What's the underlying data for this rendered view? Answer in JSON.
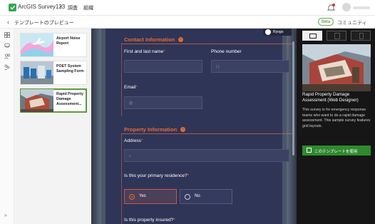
{
  "topbar": {
    "app_title": "ArcGIS Survey123",
    "nav_survey": "調査",
    "nav_org": "組織",
    "icons": {
      "logo": "survey123-logo-icon",
      "notification": "bell-icon",
      "account": "avatar"
    },
    "colors": {
      "notification_dot": "#d83020"
    }
  },
  "subheader": {
    "back_glyph": "‹",
    "title": "テンプレートのプレビュー",
    "beta": "Beta",
    "community": "コミュニティ"
  },
  "templates": [
    {
      "name": "Airport Noise Report"
    },
    {
      "name": "POET System Sampling Form"
    },
    {
      "name": "Rapid Property Damage Assessment...",
      "selected": true
    }
  ],
  "form": {
    "account_chip": "Ryogo",
    "sections": {
      "contact": {
        "title": "Contact Information",
        "icon": "collapse-icon"
      },
      "property": {
        "title": "Property Information",
        "icon": "collapse-icon"
      }
    },
    "fields": {
      "first_last_name": {
        "label": "First and last name",
        "required": "*",
        "value": ""
      },
      "phone": {
        "label": "Phone number",
        "value": "",
        "hint": "(   )"
      },
      "email": {
        "label": "Email",
        "required": "*",
        "hint": "@"
      },
      "address": {
        "label": "Address",
        "required": "*",
        "hint": "⌕"
      },
      "primary_residence": {
        "label": "Is this your primary residence?",
        "required": "*",
        "options": [
          "Yes",
          "No"
        ],
        "selected": "Yes"
      },
      "insured": {
        "label": "Is this property insured?",
        "required": "*"
      }
    },
    "colors": {
      "accent": "#e06a3c",
      "card": "#2f3557"
    }
  },
  "preview_panel": {
    "devices": [
      "desktop-icon",
      "tablet-icon",
      "phone-icon"
    ],
    "active_device": "desktop",
    "title": "Rapid Property Damage Assessment (Web Designer)",
    "description": "This survey is for emergency response teams who want to do a rapid damage assessment. This sample survey features grid layouts.",
    "use_button": "このテンプレートを使用",
    "colors": {
      "use_button": "#2f8a2f"
    }
  }
}
